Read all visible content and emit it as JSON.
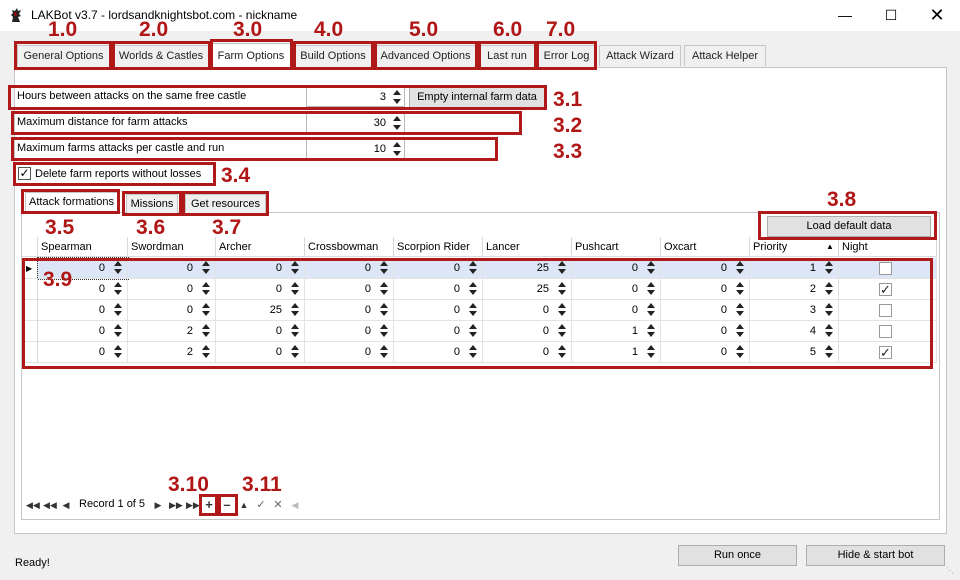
{
  "window": {
    "title": "LAKBot v3.7 - lordsandknightsbot.com - nickname",
    "minimize_icon": "minimize-icon",
    "maximize_icon": "maximize-icon",
    "close_icon": "close-icon"
  },
  "tabs": [
    {
      "label": "General Options",
      "annotation": "1.0"
    },
    {
      "label": "Worlds & Castles",
      "annotation": "2.0"
    },
    {
      "label": "Farm Options",
      "annotation": "3.0",
      "active": true
    },
    {
      "label": "Build Options",
      "annotation": "4.0"
    },
    {
      "label": "Advanced Options",
      "annotation": "5.0"
    },
    {
      "label": "Last run",
      "annotation": "6.0"
    },
    {
      "label": "Error Log",
      "annotation": "7.0"
    },
    {
      "label": "Attack Wizard"
    },
    {
      "label": "Attack Helper"
    }
  ],
  "farm_options": {
    "hours_label": "Hours between attacks on the same free castle",
    "hours_value": "3",
    "empty_button": "Empty internal farm data",
    "distance_label": "Maximum distance for farm attacks",
    "distance_value": "30",
    "max_farms_label": "Maximum farms attacks per castle and run",
    "max_farms_value": "10",
    "delete_reports_label": "Delete farm reports without losses",
    "delete_reports_checked": true
  },
  "inner_tabs": [
    {
      "label": "Attack formations",
      "active": true
    },
    {
      "label": "Missions"
    },
    {
      "label": "Get resources"
    }
  ],
  "load_default_button": "Load default data",
  "annotations": {
    "a31": "3.1",
    "a32": "3.2",
    "a33": "3.3",
    "a34": "3.4",
    "a35": "3.5",
    "a36": "3.6",
    "a37": "3.7",
    "a38": "3.8",
    "a39": "3.9",
    "a310": "3.10",
    "a311": "3.11"
  },
  "grid": {
    "columns": [
      "Spearman",
      "Swordman",
      "Archer",
      "Crossbowman",
      "Scorpion Rider",
      "Lancer",
      "Pushcart",
      "Oxcart",
      "Priority",
      "Night"
    ],
    "sort_indicator_icon": "sort-ascending-icon",
    "rows": [
      {
        "values": [
          "0",
          "0",
          "0",
          "0",
          "0",
          "25",
          "0",
          "0",
          "1"
        ],
        "night": false,
        "selected": true
      },
      {
        "values": [
          "0",
          "0",
          "0",
          "0",
          "0",
          "25",
          "0",
          "0",
          "2"
        ],
        "night": true
      },
      {
        "values": [
          "0",
          "0",
          "25",
          "0",
          "0",
          "0",
          "0",
          "0",
          "3"
        ],
        "night": false
      },
      {
        "values": [
          "0",
          "2",
          "0",
          "0",
          "0",
          "0",
          "1",
          "0",
          "4"
        ],
        "night": false
      },
      {
        "values": [
          "0",
          "2",
          "0",
          "0",
          "0",
          "0",
          "1",
          "0",
          "5"
        ],
        "night": true
      }
    ]
  },
  "navigator": {
    "record_text": "Record 1 of 5"
  },
  "footer": {
    "status": "Ready!",
    "run_once": "Run once",
    "hide_start": "Hide & start bot"
  }
}
